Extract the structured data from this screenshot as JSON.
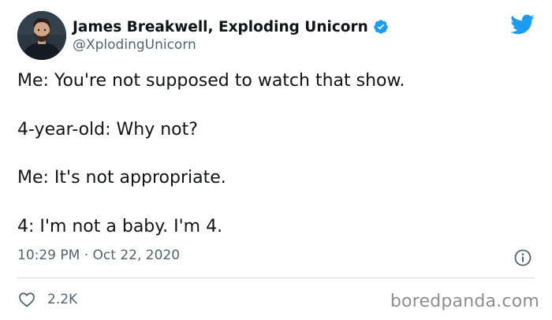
{
  "author": {
    "display_name": "James Breakwell, Exploding Unicorn",
    "handle": "@XplodingUnicorn",
    "verified_icon": "verified-badge-icon",
    "avatar_icon": "profile-photo"
  },
  "brand": {
    "icon": "twitter-bird-icon",
    "color": "#1d9bf0"
  },
  "tweet": {
    "lines": [
      "Me: You're not supposed to watch that show.",
      "4-year-old: Why not?",
      "Me: It's not appropriate.",
      "4: I'm not a baby. I'm 4."
    ],
    "timestamp": "10:29 PM · Oct 22, 2020"
  },
  "actions": {
    "like_icon": "heart-icon",
    "like_count": "2.2K",
    "info_icon": "info-icon"
  },
  "watermark": {
    "text": "boredpanda.com"
  },
  "colors": {
    "text_primary": "#0f1419",
    "text_secondary": "#536471",
    "divider": "#cfd9de",
    "verified": "#1d9bf0"
  }
}
